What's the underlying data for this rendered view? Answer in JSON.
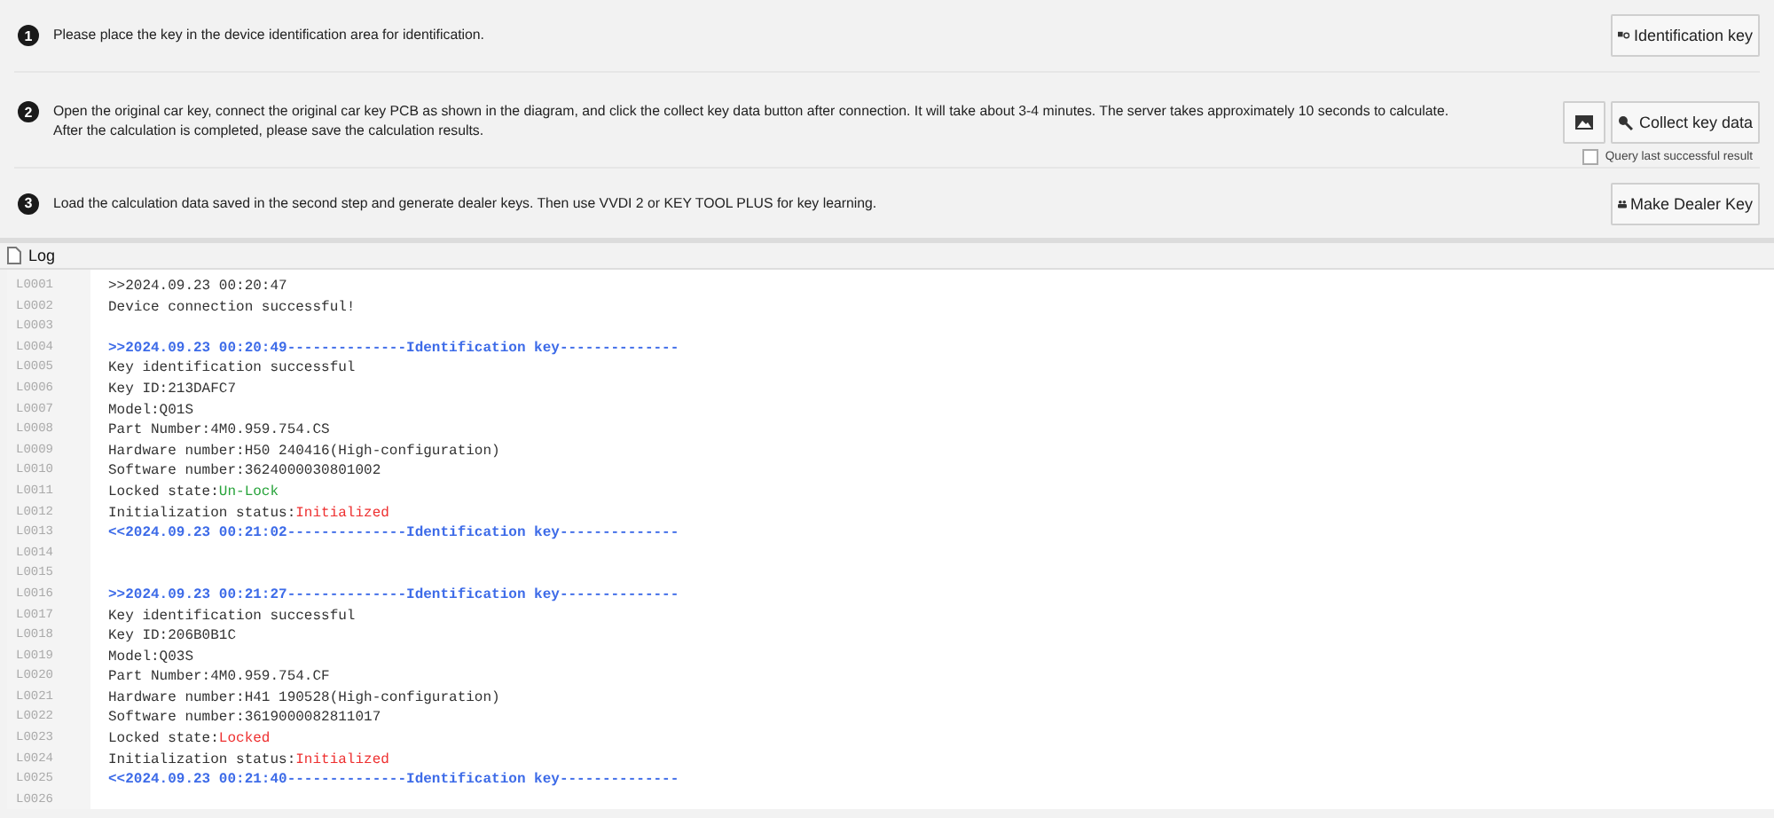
{
  "steps": [
    {
      "number": "1",
      "text": "Please place the key in the device identification area for identification.",
      "buttons": [
        {
          "kind": "identify",
          "label": "Identification key"
        }
      ]
    },
    {
      "number": "2",
      "text": "Open the original car key, connect the original car key PCB as shown in the diagram, and click the collect key data button after connection. It will take about 3-4 minutes. The server takes approximately 10 seconds to calculate.\nAfter the calculation is completed, please save the calculation results.",
      "buttons": [
        {
          "kind": "image"
        },
        {
          "kind": "collect",
          "label": "Collect key data"
        }
      ],
      "option": {
        "label": "Query last successful result",
        "checked": false
      }
    },
    {
      "number": "3",
      "text": "Load the calculation data saved in the second step and generate dealer keys. Then use VVDI 2 or KEY TOOL PLUS for key learning.",
      "buttons": [
        {
          "kind": "dealer",
          "label": "Make Dealer Key"
        }
      ]
    }
  ],
  "log": {
    "title": "Log",
    "lines": [
      {
        "number": "L0001",
        "segments": [
          {
            "kind": "normal",
            "text": ">>2024.09.23 00:20:47"
          }
        ]
      },
      {
        "number": "L0002",
        "segments": [
          {
            "kind": "normal",
            "text": "Device connection successful!"
          }
        ]
      },
      {
        "number": "L0003"
      },
      {
        "number": "L0004",
        "segments": [
          {
            "kind": "header",
            "text": ">>2024.09.23 00:20:49--------------Identification key--------------"
          }
        ]
      },
      {
        "number": "L0005",
        "segments": [
          {
            "kind": "normal",
            "text": "Key identification successful"
          }
        ]
      },
      {
        "number": "L0006",
        "segments": [
          {
            "kind": "normal",
            "text": "Key ID:213DAFC7"
          }
        ]
      },
      {
        "number": "L0007",
        "segments": [
          {
            "kind": "normal",
            "text": "Model:Q01S"
          }
        ]
      },
      {
        "number": "L0008",
        "segments": [
          {
            "kind": "normal",
            "text": "Part Number:4M0.959.754.CS"
          }
        ]
      },
      {
        "number": "L0009",
        "segments": [
          {
            "kind": "normal",
            "text": "Hardware number:H50 240416(High-configuration)"
          }
        ]
      },
      {
        "number": "L0010",
        "segments": [
          {
            "kind": "normal",
            "text": "Software number:3624000030801002"
          }
        ]
      },
      {
        "number": "L0011",
        "segments": [
          {
            "kind": "normal",
            "text": "Locked state:"
          },
          {
            "kind": "good",
            "text": "Un-Lock"
          }
        ]
      },
      {
        "number": "L0012",
        "segments": [
          {
            "kind": "normal",
            "text": "Initialization status:"
          },
          {
            "kind": "bad",
            "text": "Initialized"
          }
        ]
      },
      {
        "number": "L0013",
        "segments": [
          {
            "kind": "header",
            "text": "<<2024.09.23 00:21:02--------------Identification key--------------"
          }
        ]
      },
      {
        "number": "L0014"
      },
      {
        "number": "L0015"
      },
      {
        "number": "L0016",
        "segments": [
          {
            "kind": "header",
            "text": ">>2024.09.23 00:21:27--------------Identification key--------------"
          }
        ]
      },
      {
        "number": "L0017",
        "segments": [
          {
            "kind": "normal",
            "text": "Key identification successful"
          }
        ]
      },
      {
        "number": "L0018",
        "segments": [
          {
            "kind": "normal",
            "text": "Key ID:206B0B1C"
          }
        ]
      },
      {
        "number": "L0019",
        "segments": [
          {
            "kind": "normal",
            "text": "Model:Q03S"
          }
        ]
      },
      {
        "number": "L0020",
        "segments": [
          {
            "kind": "normal",
            "text": "Part Number:4M0.959.754.CF"
          }
        ]
      },
      {
        "number": "L0021",
        "segments": [
          {
            "kind": "normal",
            "text": "Hardware number:H41 190528(High-configuration)"
          }
        ]
      },
      {
        "number": "L0022",
        "segments": [
          {
            "kind": "normal",
            "text": "Software number:3619000082811017"
          }
        ]
      },
      {
        "number": "L0023",
        "segments": [
          {
            "kind": "normal",
            "text": "Locked state:"
          },
          {
            "kind": "bad",
            "text": "Locked"
          }
        ]
      },
      {
        "number": "L0024",
        "segments": [
          {
            "kind": "normal",
            "text": "Initialization status:"
          },
          {
            "kind": "bad",
            "text": "Initialized"
          }
        ]
      },
      {
        "number": "L0025",
        "segments": [
          {
            "kind": "header",
            "text": "<<2024.09.23 00:21:40--------------Identification key--------------"
          }
        ]
      },
      {
        "number": "L0026"
      }
    ]
  }
}
